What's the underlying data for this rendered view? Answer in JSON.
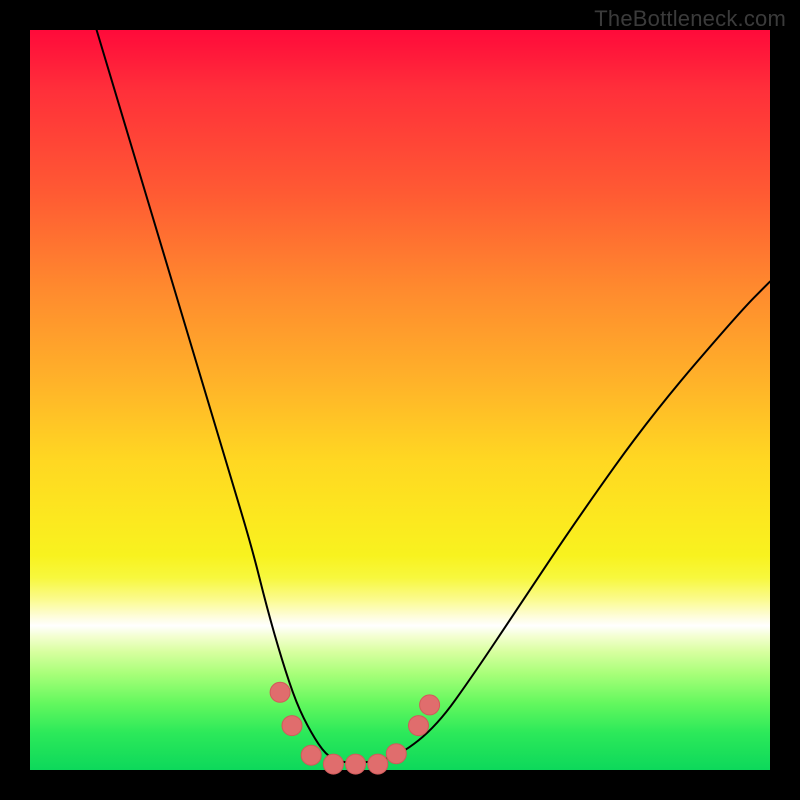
{
  "watermark": "TheBottleneck.com",
  "chart_data": {
    "type": "line",
    "title": "",
    "xlabel": "",
    "ylabel": "",
    "xlim": [
      0,
      100
    ],
    "ylim": [
      0,
      100
    ],
    "grid": false,
    "series": [
      {
        "name": "bottleneck-curve",
        "x": [
          9,
          12,
          15,
          18,
          21,
          24,
          27,
          30,
          32,
          34,
          36,
          38,
          40,
          42,
          46,
          50,
          55,
          60,
          66,
          74,
          84,
          96,
          100
        ],
        "values": [
          100,
          90,
          80,
          70,
          60,
          50,
          40,
          30,
          22,
          15,
          9,
          5,
          2,
          1,
          1,
          2,
          6,
          13,
          22,
          34,
          48,
          62,
          66
        ]
      }
    ],
    "markers": [
      {
        "name": "trough-marker",
        "x": 33.8,
        "y": 10.5
      },
      {
        "name": "trough-marker",
        "x": 35.4,
        "y": 6.0
      },
      {
        "name": "trough-marker",
        "x": 38.0,
        "y": 2.0
      },
      {
        "name": "trough-marker",
        "x": 41.0,
        "y": 0.8
      },
      {
        "name": "trough-marker",
        "x": 44.0,
        "y": 0.8
      },
      {
        "name": "trough-marker",
        "x": 47.0,
        "y": 0.8
      },
      {
        "name": "trough-marker",
        "x": 49.5,
        "y": 2.2
      },
      {
        "name": "trough-marker",
        "x": 52.5,
        "y": 6.0
      },
      {
        "name": "trough-marker",
        "x": 54.0,
        "y": 8.8
      }
    ],
    "colors": {
      "curve": "#000000",
      "marker_fill": "#e06d6d",
      "marker_stroke": "#d15a5a"
    }
  }
}
